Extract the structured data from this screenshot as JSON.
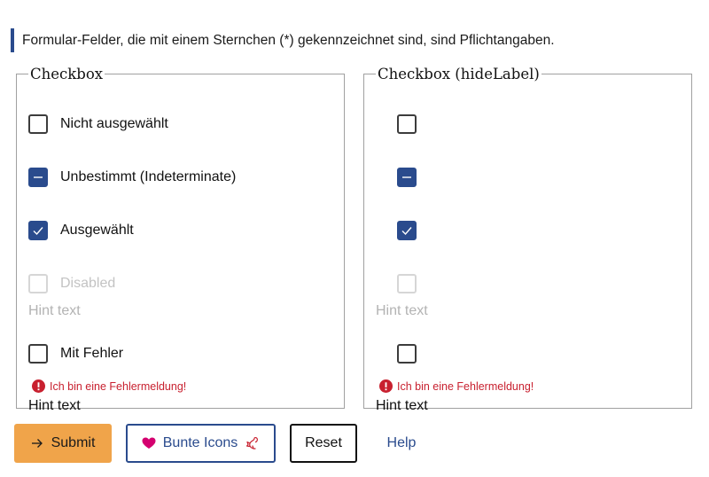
{
  "notice": {
    "text": "Formular-Felder, die mit einem Sternchen (*) gekennzeichnet sind, sind Pflichtangaben."
  },
  "fieldsets": [
    {
      "legend": "Checkbox",
      "items": [
        {
          "label": "Nicht ausgewählt",
          "state": "unchecked"
        },
        {
          "label": "Unbestimmt (Indeterminate)",
          "state": "indeterminate"
        },
        {
          "label": "Ausgewählt",
          "state": "checked"
        },
        {
          "label": "Disabled",
          "state": "disabled",
          "hint": "Hint text"
        },
        {
          "label": "Mit Fehler",
          "state": "unchecked",
          "error": "Ich bin eine Fehlermeldung!",
          "hint": "Hint text"
        }
      ]
    },
    {
      "legend": "Checkbox (hideLabel)",
      "items": [
        {
          "state": "unchecked"
        },
        {
          "state": "indeterminate"
        },
        {
          "state": "checked"
        },
        {
          "state": "disabled",
          "hint": "Hint text"
        },
        {
          "state": "unchecked",
          "error": "Ich bin eine Fehlermeldung!",
          "hint": "Hint text"
        }
      ]
    }
  ],
  "buttons": {
    "submit": {
      "label": "Submit",
      "icon": "arrow-right-icon"
    },
    "icons": {
      "label": "Bunte Icons",
      "icon_left": "heart-icon",
      "icon_right": "squirrel-icon"
    },
    "reset": {
      "label": "Reset"
    },
    "help": {
      "label": "Help"
    }
  },
  "colors": {
    "primary": "#2a4b8d",
    "accent": "#f0a44a",
    "error": "#c8202f",
    "heart": "#d4006f",
    "squirrel": "#c8202f"
  }
}
